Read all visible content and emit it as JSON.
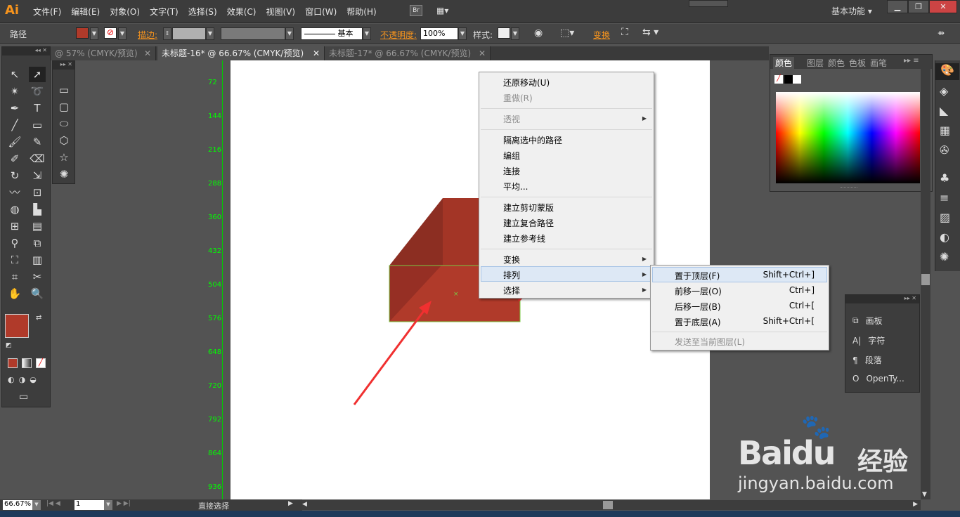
{
  "app": {
    "logo": "Ai",
    "br": "Br",
    "workspace": "基本功能 ▾"
  },
  "menus": [
    "文件(F)",
    "编辑(E)",
    "对象(O)",
    "文字(T)",
    "选择(S)",
    "效果(C)",
    "视图(V)",
    "窗口(W)",
    "帮助(H)"
  ],
  "control": {
    "path_label": "路径",
    "stroke_label": "描边:",
    "stroke_profile": "基本",
    "opacity_label": "不透明度:",
    "opacity_value": "100%",
    "style_label": "样式:",
    "transform_label": "变换",
    "fill_color": "#b03a2a"
  },
  "tabs": [
    {
      "label": "@ 57% (CMYK/预览)",
      "active": false
    },
    {
      "label": "未标题-16* @ 66.67% (CMYK/预览)",
      "active": true
    },
    {
      "label": "未标题-17* @ 66.67% (CMYK/预览)",
      "active": false
    }
  ],
  "ruler": [
    "72",
    "144",
    "216",
    "288",
    "360",
    "432",
    "504",
    "576",
    "648",
    "720",
    "792",
    "864",
    "936"
  ],
  "context_menu": {
    "items": [
      {
        "label": "还原移动(U)",
        "disabled": false
      },
      {
        "label": "重做(R)",
        "disabled": true
      },
      {
        "label": "透视",
        "disabled": true,
        "submenu": true
      },
      {
        "label": "隔离选中的路径",
        "disabled": false
      },
      {
        "label": "编组",
        "disabled": false
      },
      {
        "label": "连接",
        "disabled": false
      },
      {
        "label": "平均...",
        "disabled": false
      },
      {
        "label": "建立剪切蒙版",
        "disabled": false
      },
      {
        "label": "建立复合路径",
        "disabled": false
      },
      {
        "label": "建立参考线",
        "disabled": false
      },
      {
        "label": "变换",
        "disabled": false,
        "submenu": true
      },
      {
        "label": "排列",
        "disabled": false,
        "submenu": true
      },
      {
        "label": "选择",
        "disabled": false,
        "submenu": true
      }
    ]
  },
  "submenu": {
    "items": [
      {
        "label": "置于顶层(F)",
        "shortcut": "Shift+Ctrl+]"
      },
      {
        "label": "前移一层(O)",
        "shortcut": "Ctrl+]"
      },
      {
        "label": "后移一层(B)",
        "shortcut": "Ctrl+["
      },
      {
        "label": "置于底层(A)",
        "shortcut": "Shift+Ctrl+["
      },
      {
        "label": "发送至当前图层(L)",
        "shortcut": ""
      }
    ]
  },
  "color_panel": {
    "tabs": [
      "颜色",
      "图层",
      "颜色",
      "色板",
      "画笔"
    ]
  },
  "char_panel": {
    "items": [
      "画板",
      "字符",
      "段落",
      "OpenTy..."
    ]
  },
  "status": {
    "zoom": "66.67%",
    "page": "1",
    "tool": "直接选择"
  },
  "watermark": {
    "brand": "Bai",
    "brand2": "du",
    "cn": "经验",
    "url": "jingyan.baidu.com"
  },
  "colors": {
    "shape_front": "#b03a2a",
    "shape_side": "#8c2e22",
    "shape_top": "#a33526",
    "arrow": "#f03030",
    "selection": "#7ac943"
  }
}
